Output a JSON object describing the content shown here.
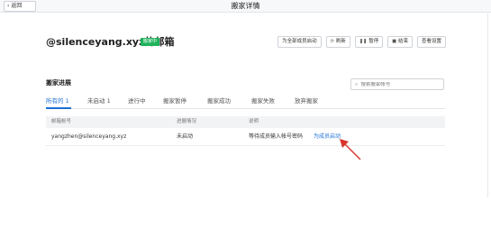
{
  "header": {
    "back_label": "返回",
    "title": "搬家详情"
  },
  "mailbox": {
    "title": "@silenceyang.xyz的邮箱",
    "status": "搬家中"
  },
  "actions": [
    {
      "label": "为全部成员启动",
      "icon": ""
    },
    {
      "label": "刷新",
      "icon": "refresh-icon"
    },
    {
      "label": "暂停",
      "icon": "pause-icon"
    },
    {
      "label": "结束",
      "icon": "stop-icon"
    },
    {
      "label": "查看设置",
      "icon": ""
    }
  ],
  "progress": {
    "title": "搬家进展",
    "search_placeholder": "搜索搬家帐号",
    "tabs": [
      {
        "label": "所有的",
        "count": "1",
        "active": true
      },
      {
        "label": "未启动",
        "count": "1",
        "active": false
      },
      {
        "label": "进行中",
        "count": "",
        "active": false
      },
      {
        "label": "搬家暂停",
        "count": "",
        "active": false
      },
      {
        "label": "搬家成功",
        "count": "",
        "active": false
      },
      {
        "label": "搬家失败",
        "count": "",
        "active": false
      },
      {
        "label": "放弃搬家",
        "count": "",
        "active": false
      }
    ]
  },
  "table": {
    "columns": [
      "邮箱帐号",
      "进展情况",
      "说明"
    ],
    "rows": [
      {
        "account": "yangzhen@silenceyang.xyz",
        "status": "未启动",
        "note": "等待成员输入帐号密码",
        "link": "为成员启动"
      }
    ]
  },
  "colors": {
    "accent": "#1c6fd6",
    "badge": "#1fb25a",
    "arrow": "#d9342b"
  }
}
